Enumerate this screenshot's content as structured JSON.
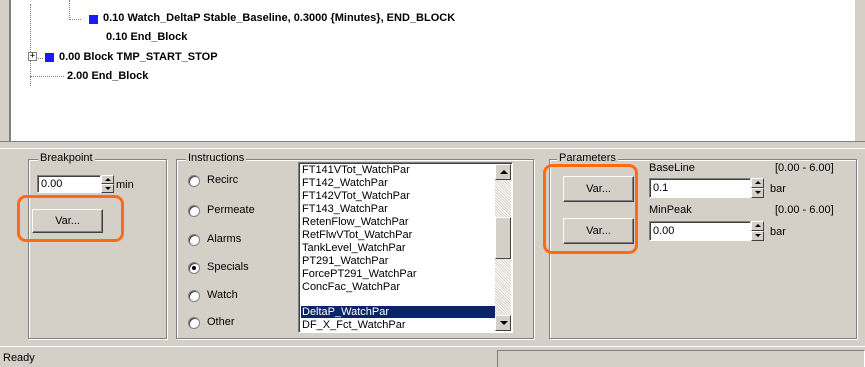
{
  "tree": {
    "lines": [
      "0.10  Watch_DeltaP  Stable_Baseline, 0.3000 {Minutes}, END_BLOCK",
      "0.10  End_Block",
      "0.00  Block  TMP_START_STOP",
      "2.00  End_Block"
    ],
    "expander": "+"
  },
  "breakpoint": {
    "title": "Breakpoint",
    "value": "0.00",
    "unit": "min",
    "var_button": "Var..."
  },
  "instructions": {
    "title": "Instructions",
    "options": [
      "Recirc",
      "Permeate",
      "Alarms",
      "Specials",
      "Watch",
      "Other"
    ],
    "selected": "Specials",
    "list": [
      "FT141VTot_WatchPar",
      "FT142_WatchPar",
      "FT142VTot_WatchPar",
      "FT143_WatchPar",
      "RetenFlow_WatchPar",
      "RetFlwVTot_WatchPar",
      "TankLevel_WatchPar",
      "PT291_WatchPar",
      "ForcePT291_WatchPar",
      "ConcFac_WatchPar",
      "DeltaP_WatchPar",
      "DF_X_Fct_WatchPar"
    ],
    "list_selected": "DeltaP_WatchPar"
  },
  "parameters": {
    "title": "Parameters",
    "items": [
      {
        "button": "Var...",
        "name": "BaseLine",
        "range": "[0.00 - 6.00]",
        "value": "0.1",
        "unit": "bar"
      },
      {
        "button": "Var...",
        "name": "MinPeak",
        "range": "[0.00 - 6.00]",
        "value": "0.00",
        "unit": "bar"
      }
    ]
  },
  "status": {
    "text": "Ready"
  },
  "colors": {
    "highlight_ring": "#ff6a13",
    "selection": "#0a246a",
    "node": "#1a1aff"
  }
}
